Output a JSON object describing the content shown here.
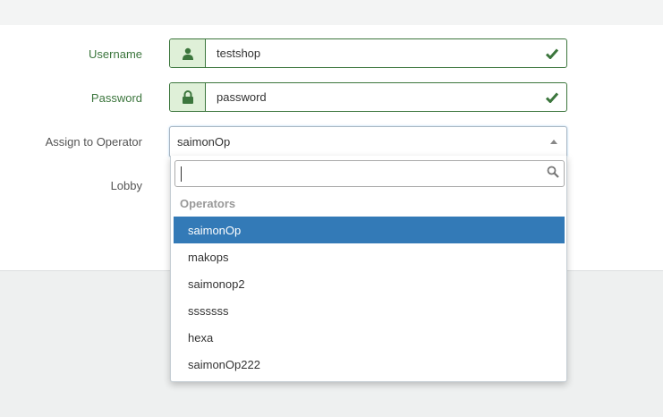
{
  "form": {
    "username": {
      "label": "Username",
      "value": "testshop",
      "icon": "user-icon"
    },
    "password": {
      "label": "Password",
      "value": "password",
      "icon": "lock-icon"
    },
    "operator": {
      "label": "Assign to Operator",
      "selected": "saimonOp"
    },
    "lobby": {
      "label": "Lobby"
    }
  },
  "dropdown": {
    "search_value": "",
    "group_label": "Operators",
    "options": [
      "saimonOp",
      "makops",
      "saimonop2",
      "sssssss",
      "hexa",
      "saimonOp222"
    ],
    "highlighted": "saimonOp"
  },
  "colors": {
    "success": "#3c763d",
    "success_bg": "#dff0d8",
    "highlight": "#337ab7"
  }
}
